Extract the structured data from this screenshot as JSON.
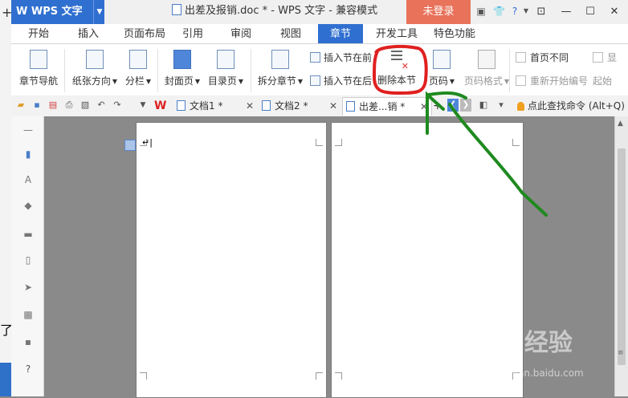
{
  "background_window": {
    "left_text": "了"
  },
  "titlebar": {
    "app_name": "W WPS 文字",
    "doc_title": "出差及报销.doc * - WPS 文字 - 兼容模式",
    "login_label": "未登录"
  },
  "ribbon_tabs": [
    {
      "label": "开始"
    },
    {
      "label": "插入"
    },
    {
      "label": "页面布局"
    },
    {
      "label": "引用"
    },
    {
      "label": "审阅"
    },
    {
      "label": "视图"
    },
    {
      "label": "章节",
      "active": true
    },
    {
      "label": "开发工具"
    },
    {
      "label": "特色功能"
    }
  ],
  "ribbon": {
    "section_nav": "章节导航",
    "paper_direction": "纸张方向",
    "columns": "分栏",
    "cover_page": "封面页",
    "toc_page": "目录页",
    "split_chapter": "拆分章节",
    "insert_section_before": "插入节在前",
    "insert_section_after": "插入节在后",
    "delete_section": "删除本节",
    "page_number": "页码",
    "page_number_format": "页码格式",
    "different_first_page": "首页不同",
    "restart_numbering": "重新开始编号",
    "start_label": "起始",
    "show_label": "显"
  },
  "doc_tabs": {
    "tabs": [
      {
        "label": "文档1 *"
      },
      {
        "label": "文档2 *"
      },
      {
        "label": "出差...销 *",
        "active": true
      }
    ],
    "find_command": "点此查找命令 (Alt+Q)",
    "plus": "+"
  },
  "watermark": {
    "text": "Bai 经验",
    "sub": "jingyan.baidu.com"
  },
  "colors": {
    "accent_blue": "#2f6fd0",
    "login_red": "#e8725a",
    "annotation_red": "#e02020",
    "annotation_green": "#1f8a1f"
  }
}
